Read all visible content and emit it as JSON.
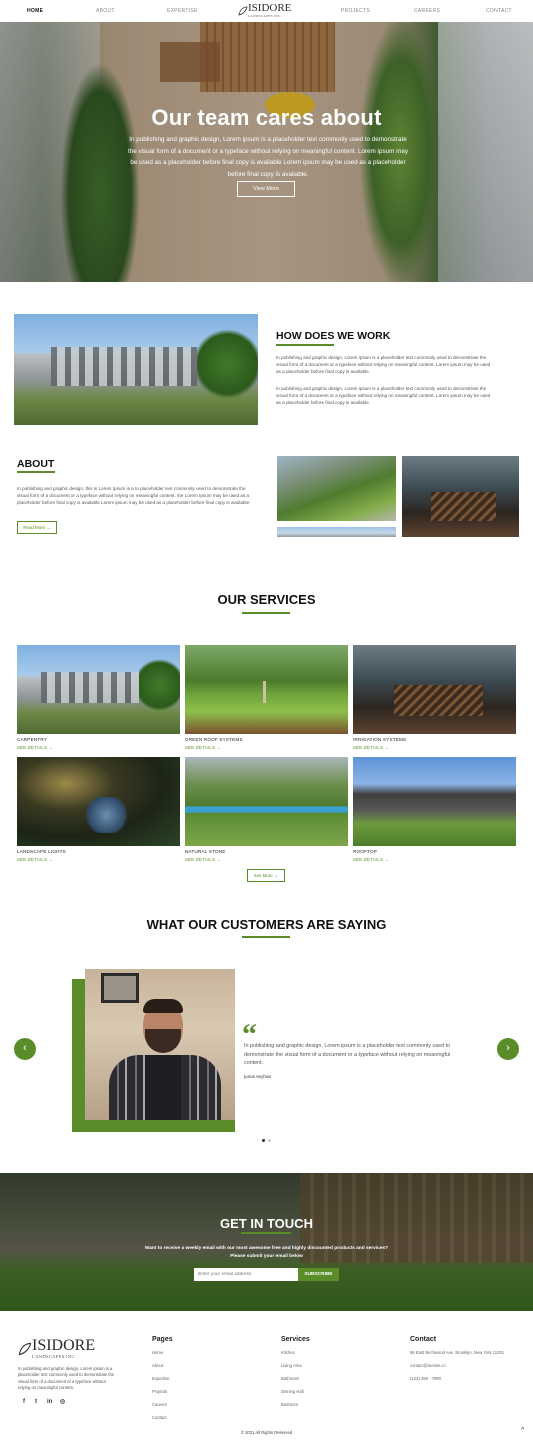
{
  "nav": {
    "items": [
      "HOME",
      "ABOUT",
      "EXPERTISE",
      "PROJECTS",
      "CAREERS",
      "CONTACT"
    ],
    "logo": {
      "name": "ISIDORE",
      "tagline": "LANDSCAPES INC."
    }
  },
  "hero": {
    "title": "Our team cares about",
    "text": "In publishing and graphic design, Lorem ipsum is a placeholder text commonly used to demonstrate the visual form of a document or a typeface without relying on meaningful content. Lorem ipsum may be used as a placeholder before final copy is available Lorem ipsum may be used as a placeholder before final copy is available.",
    "button": "View More"
  },
  "how": {
    "title": "HOW DOES WE WORK",
    "p1": "In publishing and graphic design, Lorem ipsum is a placeholder text commonly used to demonstrate the visual form of a document or a typeface without relying on meaningful content. Lorem ipsum may be used as a placeholder before final copy is available.",
    "p2": "In publishing and graphic design, Lorem ipsum is a placeholder text commonly used to demonstrate the visual form of a document or a typeface without relying on meaningful content. Lorem ipsum may be used as a placeholder before final copy is available."
  },
  "about": {
    "title": "ABOUT",
    "text": "In publishing and graphic design, this is Lorem Ipsum is a to placeholder text commonly used to demonstrate the visual form of a document or a typeface without relying on meaningful content. the Lorem Ipsum may be used as a placeholder before final copy is available Lorem ipsum may be used as a placeholder before final copy is available.",
    "button": "Read More →"
  },
  "services": {
    "title": "OUR SERVICES",
    "items": [
      {
        "label": "CARPENTRY",
        "link": "SEE DETAILS →"
      },
      {
        "label": "GREEN ROOF SYSTEMS",
        "link": "SEE DETAILS →"
      },
      {
        "label": "IRRIGATION SYSTEMS",
        "link": "SEE DETAILS →"
      },
      {
        "label": "LANDSCAPE LIGHTS",
        "link": "SEE DETAILS →"
      },
      {
        "label": "NATURAL STONE",
        "link": "SEE DETAILS →"
      },
      {
        "label": "ROOFTOP",
        "link": "SEE DETAILS →"
      }
    ],
    "button": "See More →"
  },
  "testimonials": {
    "title": "WHAT OUR CUSTOMERS ARE SAYING",
    "quote": "In publishing and graphic design, Lorem ipsum is a placeholder text commonly used to demonstrate the visual form of a document or a typeface without relying on meaningful content.",
    "author": "junus seyhan",
    "prev": "‹",
    "next": "›"
  },
  "contact": {
    "title": "GET IN TOUCH",
    "text1": "Want to receive a weekly email with our most awesome free and highly discounted products and services?",
    "text2": "Please submit your email below",
    "placeholder": "Enter your email address",
    "button": "SUBSCRIBE"
  },
  "footer": {
    "about": "In publishing and graphic design, Lorem ipsum is a placeholder text commonly used to demonstrate the visual form of a document or a typeface without relying on meaningful content.",
    "social": [
      "f",
      "t",
      "in",
      "◎"
    ],
    "pages": {
      "title": "Pages",
      "links": [
        "Home",
        "About",
        "Expertise",
        "Projects",
        "Careers",
        "Contact"
      ]
    },
    "services": {
      "title": "Services",
      "links": [
        "Kitchen",
        "Living Area",
        "Bathroom",
        "Dinning Hall",
        "Bedroom"
      ]
    },
    "contact": {
      "title": "Contact",
      "address": "96 East Birchwood Ave. Brooklyn, New York 11201",
      "email": "contact@mesite.co",
      "phone": "(123) 456 - 7890"
    },
    "copyright": "© 2021 All Rights Reserved",
    "top": "^"
  },
  "colors": {
    "accent": "#5b8c2a"
  }
}
